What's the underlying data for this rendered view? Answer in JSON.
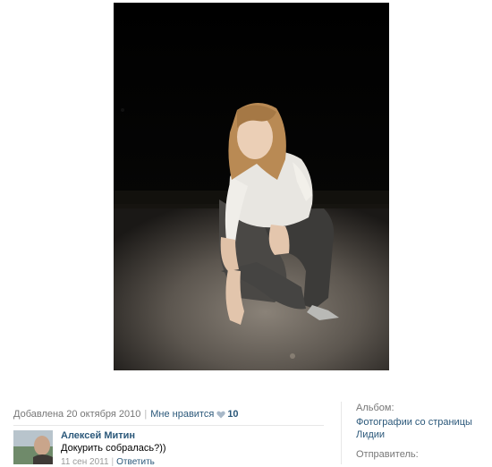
{
  "photo": {
    "alt": "photo"
  },
  "meta": {
    "added": "Добавлена 20 октября 2010",
    "separator": "|",
    "like_label": "Мне нравится",
    "like_count": "10"
  },
  "comment": {
    "author": "Алексей Митин",
    "text": "Докурить собралась?))",
    "date": "11 сен 2011",
    "separator": "|",
    "reply": "Ответить"
  },
  "sidebar": {
    "album_label": "Альбом:",
    "album_name": "Фотографии со страницы Лидии",
    "sender_label": "Отправитель:"
  },
  "colors": {
    "link": "#2b587a",
    "muted": "#777777",
    "divider": "#e7e7e7"
  }
}
